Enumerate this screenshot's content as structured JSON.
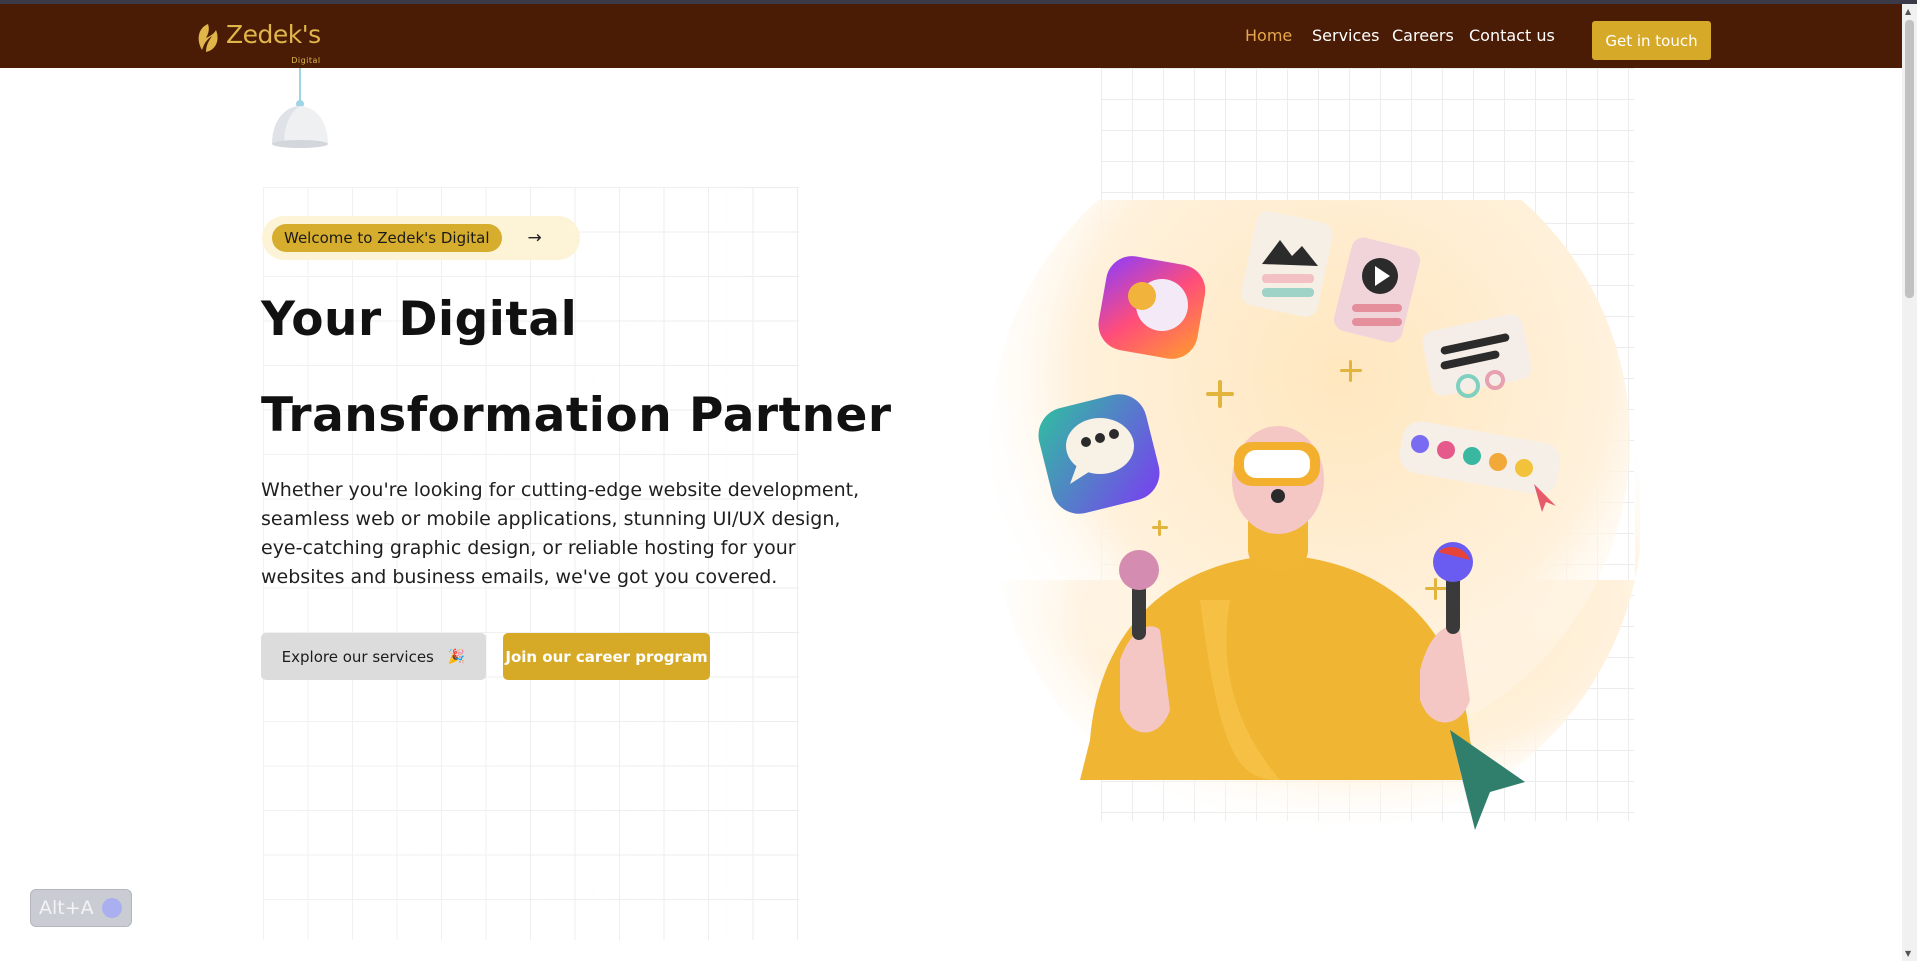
{
  "brand": {
    "name": "Zedek's",
    "sub": "Digital",
    "color": "#e0b64a"
  },
  "nav": {
    "links": [
      {
        "label": "Home",
        "active": true
      },
      {
        "label": "Services",
        "active": false
      },
      {
        "label": "Careers",
        "active": false
      },
      {
        "label": "Contact us",
        "active": false
      }
    ],
    "cta_label": "Get in touch"
  },
  "hero": {
    "welcome_label": "Welcome to Zedek's Digital",
    "welcome_arrow": "→",
    "title_line1": "Your Digital",
    "title_line2": "Transformation Partner",
    "body": "Whether you're looking for cutting-edge website development, seamless web or mobile applications, stunning UI/UX design, eye-catching graphic design, or reliable hosting for your websites and business emails, we've got you covered.",
    "explore_label": "Explore our services",
    "explore_icon": "🎉",
    "career_label": "Join our career program"
  },
  "widget": {
    "label": "Alt+A"
  },
  "colors": {
    "nav_bg": "#4a1c05",
    "accent": "#d6aa27",
    "active_link": "#e6a94a"
  }
}
